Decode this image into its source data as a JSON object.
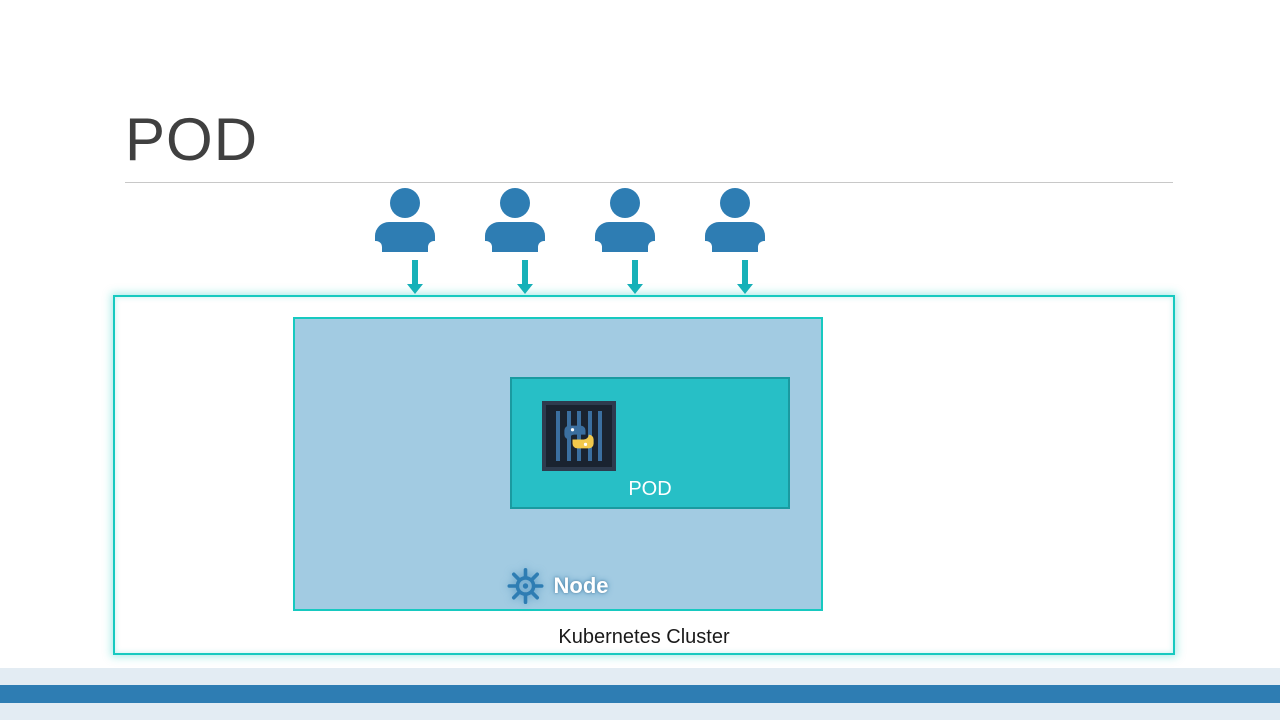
{
  "title": "POD",
  "users": [
    "user-1",
    "user-2",
    "user-3",
    "user-4"
  ],
  "labels": {
    "cluster": "Kubernetes Cluster",
    "node": "Node",
    "pod": "POD"
  },
  "icons": {
    "helm": "helm-wheel-icon",
    "container": "python-container-icon",
    "user": "user-icon",
    "arrow": "down-arrow-icon"
  },
  "colors": {
    "accent_blue": "#2e7db3",
    "teal": "#17c9c0",
    "node_bg": "#a2cbe2",
    "pod_bg": "#27bfc6"
  }
}
